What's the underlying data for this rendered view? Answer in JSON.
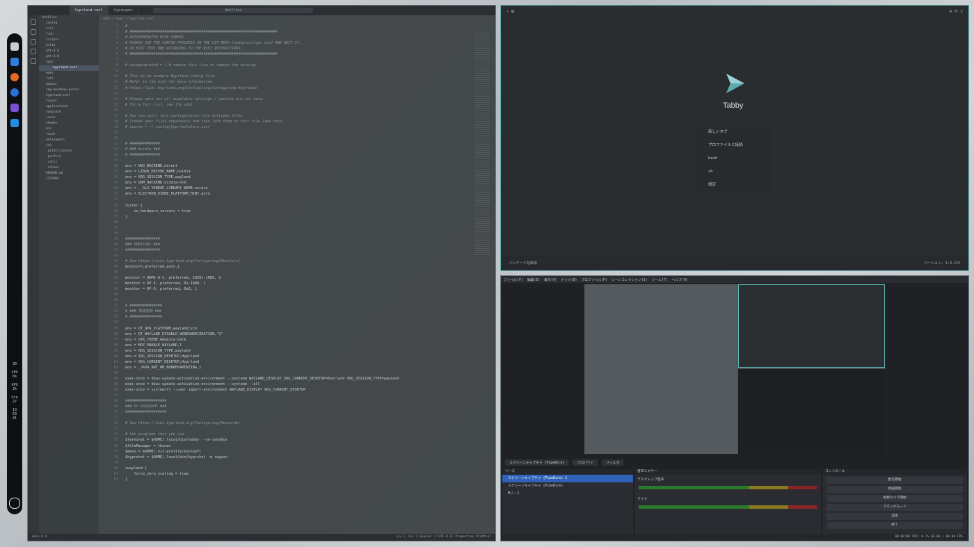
{
  "dock": {
    "stats": [
      "30",
      "SPU\n6%",
      "GPU\n2%",
      "Gra\n27",
      "13\n53\n41"
    ]
  },
  "vscode": {
    "tabs": [
      "hyprland.conf",
      "hyprpaper"
    ],
    "search": "dotfiles",
    "breadcrumb": "dots > hypr > hyprland.conf",
    "explorer": [
      "dotfiles",
      "config",
      "niri",
      "fish",
      "scripts",
      "kitty",
      "gtk-3.0",
      "gtk-4.0",
      "hypr",
      "hyprland.conf",
      "mako",
      "rofi",
      "waybar",
      "xdg-desktop-portal",
      "hyprland.conf",
      "fuzzel",
      "applications",
      "swaylock",
      "icons",
      "themes",
      "bin",
      "local",
      "wallpapers",
      "zsh",
      ".gitattributes",
      ".profile",
      ".zshrc",
      ".zshenv",
      "README.md",
      "LICENSE"
    ],
    "code": [
      {
        "n": "1",
        "t": "#",
        "c": true
      },
      {
        "n": "2",
        "t": "# ####################################################################",
        "c": true
      },
      {
        "n": "3",
        "t": "# AUTOGENERATED HYPR CONFIG.",
        "c": true
      },
      {
        "n": "4",
        "t": "# PLEASE USE THE CONFIG PROVIDED IN THE GIT REPO /examples/hypr.conf AND EDIT IT,",
        "c": true
      },
      {
        "n": "5",
        "t": "# OR EDIT THIS ONE ACCORDING TO THE WIKI INSTRUCTIONS.",
        "c": true
      },
      {
        "n": "6",
        "t": "# ####################################################################",
        "c": true
      },
      {
        "n": "7",
        "t": "",
        "c": false
      },
      {
        "n": "8",
        "t": "# autogenerated = 1 # remove this line to remove the warning",
        "c": true
      },
      {
        "n": "9",
        "t": "",
        "c": false
      },
      {
        "n": "10",
        "t": "# This is an example Hyprland config file.",
        "c": true
      },
      {
        "n": "11",
        "t": "# Refer to the wiki for more information.",
        "c": true
      },
      {
        "n": "12",
        "t": "# https://wiki.hyprland.org/Configuring/Configuring-Hyprland/",
        "c": true
      },
      {
        "n": "13",
        "t": "",
        "c": false
      },
      {
        "n": "14",
        "t": "# Please note not all available settings / options are set here.",
        "c": true
      },
      {
        "n": "15",
        "t": "# For a full list, see the wiki",
        "c": true
      },
      {
        "n": "16",
        "t": "",
        "c": false
      },
      {
        "n": "17",
        "t": "# You can split this configuration into multiple files",
        "c": true
      },
      {
        "n": "18",
        "t": "# Create your files separately and then link them to this file like this:",
        "c": true
      },
      {
        "n": "19",
        "t": "# source = ~/.config/hypr/myColors.conf",
        "c": true
      },
      {
        "n": "20",
        "t": "",
        "c": false
      },
      {
        "n": "21",
        "t": "",
        "c": false
      },
      {
        "n": "22",
        "t": "# ##############",
        "c": true
      },
      {
        "n": "23",
        "t": "# ### Nvidia ###",
        "c": true
      },
      {
        "n": "24",
        "t": "# ##############",
        "c": true
      },
      {
        "n": "25",
        "t": "",
        "c": false
      },
      {
        "n": "26",
        "t": "env = NVD_BACKEND,direct",
        "c": false
      },
      {
        "n": "27",
        "t": "env = LIBVA_DRIVER_NAME,nvidia",
        "c": false
      },
      {
        "n": "28",
        "t": "env = XDG_SESSION_TYPE,wayland",
        "c": false
      },
      {
        "n": "29",
        "t": "env = GBM_BACKEND,nvidia-drm",
        "c": false
      },
      {
        "n": "30",
        "t": "env = __GLX_VENDOR_LIBRARY_NAME,nvidia",
        "c": false
      },
      {
        "n": "31",
        "t": "env = ELECTRON_OZONE_PLATFORM_HINT,auto",
        "c": false
      },
      {
        "n": "32",
        "t": "",
        "c": false
      },
      {
        "n": "33",
        "t": "cursor {",
        "c": false
      },
      {
        "n": "34",
        "t": "    no_hardware_cursors = true",
        "c": false
      },
      {
        "n": "35",
        "t": "}",
        "c": false
      },
      {
        "n": "36",
        "t": "",
        "c": false
      },
      {
        "n": "37",
        "t": "",
        "c": false
      },
      {
        "n": "38",
        "t": "",
        "c": false
      },
      {
        "n": "39",
        "t": "################",
        "c": true
      },
      {
        "n": "40",
        "t": "### MONITORS ###",
        "c": true
      },
      {
        "n": "41",
        "t": "################",
        "c": true
      },
      {
        "n": "42",
        "t": "",
        "c": false
      },
      {
        "n": "43",
        "t": "# See https://wiki.hyprland.org/Configuring/Monitors/",
        "c": true
      },
      {
        "n": "44",
        "t": "monitor=,preferred,auto,1",
        "c": false
      },
      {
        "n": "45",
        "t": "",
        "c": false
      },
      {
        "n": "46",
        "t": "monitor = HDMI-A-2, preferred, 1920x-1080, 1",
        "c": false
      },
      {
        "n": "47",
        "t": "monitor = DP-5, preferred, 0x-1080, 1",
        "c": false
      },
      {
        "n": "48",
        "t": "monitor = DP-6, preferred, 0x0, 1",
        "c": false
      },
      {
        "n": "49",
        "t": "",
        "c": false
      },
      {
        "n": "50",
        "t": "",
        "c": false
      },
      {
        "n": "51",
        "t": "# ###############",
        "c": true
      },
      {
        "n": "52",
        "t": "# ### 環境変数 ###",
        "c": true
      },
      {
        "n": "53",
        "t": "# ###############",
        "c": true
      },
      {
        "n": "54",
        "t": "",
        "c": false
      },
      {
        "n": "55",
        "t": "env = QT_QPA_PLATFORM,wayland;xcb",
        "c": false
      },
      {
        "n": "56",
        "t": "env = QT_WAYLAND_DISABLE_WINDOWDECORATION,\"1\"",
        "c": false
      },
      {
        "n": "57",
        "t": "env = GTK_THEME,Adwaita:dark",
        "c": false
      },
      {
        "n": "58",
        "t": "env = MOZ_ENABLE_WAYLAND,1",
        "c": false
      },
      {
        "n": "59",
        "t": "env = XDG_SESSION_TYPE,wayland",
        "c": false
      },
      {
        "n": "60",
        "t": "env = XDG_SESSION_DESKTOP,Hyprland",
        "c": false
      },
      {
        "n": "61",
        "t": "env = XDG_CURRENT_DESKTOP,Hyprland",
        "c": false
      },
      {
        "n": "62",
        "t": "env = _JAVA_AWT_WM_NONREPARENTING,1",
        "c": false
      },
      {
        "n": "63",
        "t": "",
        "c": false
      },
      {
        "n": "64",
        "t": "exec-once = dbus-update-activation-environment --systemd WAYLAND_DISPLAY XDG_CURRENT_DESKTOP=Hyprland XDG_SESSION_TYPE=wayland",
        "c": false
      },
      {
        "n": "65",
        "t": "exec-once = dbus-update-activation-environment --systemd --all",
        "c": false
      },
      {
        "n": "66",
        "t": "exec-once = systemctl --user import-environment WAYLAND_DISPLAY XDG_CURRENT_DESKTOP",
        "c": false
      },
      {
        "n": "67",
        "t": "",
        "c": false
      },
      {
        "n": "68",
        "t": "###################",
        "c": true
      },
      {
        "n": "69",
        "t": "### MY PROGRAMS ###",
        "c": true
      },
      {
        "n": "70",
        "t": "###################",
        "c": true
      },
      {
        "n": "71",
        "t": "",
        "c": false
      },
      {
        "n": "72",
        "t": "# See https://wiki.hyprland.org/Configuring/Keywords/",
        "c": true
      },
      {
        "n": "73",
        "t": "",
        "c": false
      },
      {
        "n": "74",
        "t": "# Set programs that you use",
        "c": true
      },
      {
        "n": "75",
        "t": "$terminal = $HOME/.local/bin/tabby --no-sandbox",
        "c": false
      },
      {
        "n": "76",
        "t": "$fileManager = thunar",
        "c": false
      },
      {
        "n": "77",
        "t": "$menu = $HOME/.nix-profile/bin/wofi",
        "c": false
      },
      {
        "n": "78",
        "t": "$hyprshot = $HOME/.local/bin/hyprshot -m region",
        "c": false
      },
      {
        "n": "79",
        "t": "",
        "c": false
      },
      {
        "n": "80",
        "t": "xwayland {",
        "c": false
      },
      {
        "n": "81",
        "t": "    force_zero_scaling = true",
        "c": false
      },
      {
        "n": "82",
        "t": "}",
        "c": false
      }
    ],
    "status_left": "main  0  0",
    "status_right": "Ln 1, Col 1   Spaces: 4   UTF-8   LF   Properties   Prettier"
  },
  "tabby": {
    "brand": "Tabby",
    "menu": [
      "新しいタブ",
      "プロファイルと接続",
      "bash",
      "sh",
      "設定"
    ],
    "footer_left": "パッケージを取得",
    "footer_right": "バージョン: 1.0.215"
  },
  "obs": {
    "menu": [
      "ファイル(F)",
      "編集(E)",
      "表示(V)",
      "ドック(D)",
      "プロファイル(P)",
      "シーンコレクション(S)",
      "ツール(T)",
      "ヘルプ(H)"
    ],
    "preview_buttons": [
      "スクリーンキャプチャ (PipeWire)",
      "プロパティ",
      "フィルタ"
    ],
    "sources_title": "ソース",
    "sources": [
      "スクリーンキャプチャ (PipeWire) 2",
      "スクリーンキャプチャ (PipeWire)",
      "Mソース"
    ],
    "mixer_title": "音声ミキサー",
    "mixer_channels": [
      "デスクトップ音声",
      "マイク"
    ],
    "controls_title": "コントロール",
    "controls": [
      "配信開始",
      "録画開始",
      "仮想カメラ開始",
      "スタジオモード",
      "設定",
      "終了"
    ],
    "status": "00:00:00   CPU: 0.7%   60.00 / 60.00 FPS"
  }
}
